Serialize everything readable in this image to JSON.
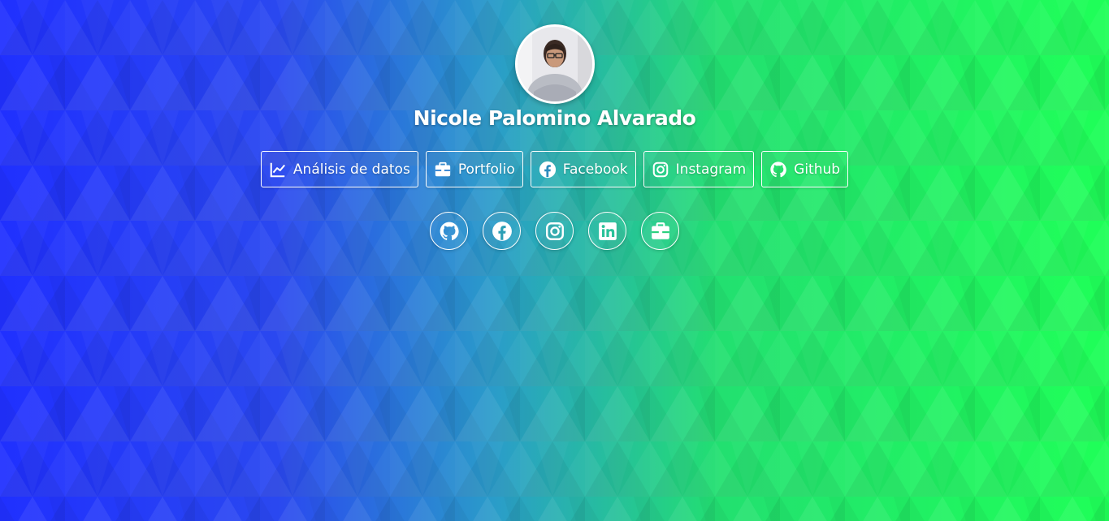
{
  "profile": {
    "name": "Nicole Palomino Alvarado"
  },
  "links": [
    {
      "label": "Análisis de datos",
      "icon": "chart-line-icon"
    },
    {
      "label": "Portfolio",
      "icon": "briefcase-icon"
    },
    {
      "label": "Facebook",
      "icon": "facebook-icon"
    },
    {
      "label": "Instagram",
      "icon": "instagram-icon"
    },
    {
      "label": "Github",
      "icon": "github-icon"
    }
  ],
  "socials": [
    {
      "icon": "github-icon"
    },
    {
      "icon": "facebook-icon"
    },
    {
      "icon": "instagram-icon"
    },
    {
      "icon": "linkedin-icon"
    },
    {
      "icon": "briefcase-icon"
    }
  ],
  "colors": {
    "gradient_left": "#2030ff",
    "gradient_mid": "#2a9ec8",
    "gradient_right": "#1fff58",
    "text": "#ffffff"
  }
}
